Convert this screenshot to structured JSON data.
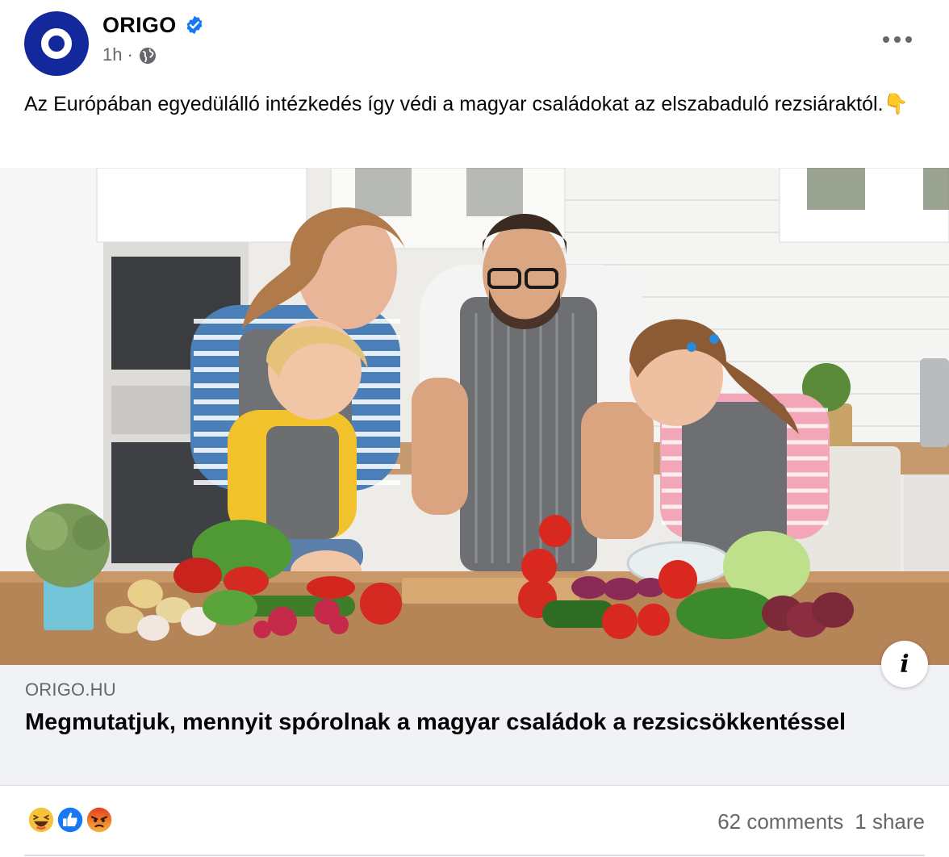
{
  "post": {
    "page_name": "ORIGO",
    "time": "1h",
    "separator": "·",
    "text": "Az Európában egyedülálló intézkedés így védi a magyar családokat az elszabaduló rezsiáraktól.👇"
  },
  "link": {
    "domain": "ORIGO.HU",
    "title": "Megmutatjuk, mennyit spórolnak a magyar családok a rezsicsökkentéssel"
  },
  "engagement": {
    "reactions": [
      "haha-icon",
      "like-icon",
      "angry-icon"
    ],
    "comments": "62 comments",
    "shares": "1 share"
  },
  "colors": {
    "brand": "#13289a",
    "verified": "#1877f2",
    "secondary_text": "#65676b",
    "link_box_bg": "#f0f2f5"
  }
}
